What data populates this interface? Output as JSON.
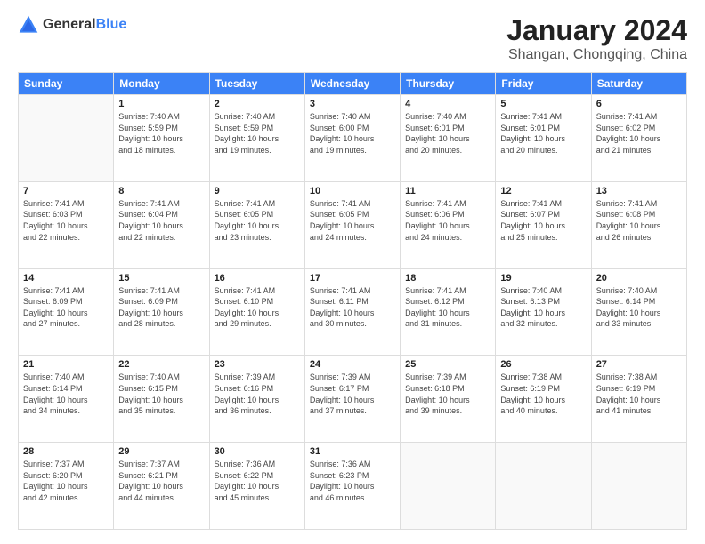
{
  "logo": {
    "general": "General",
    "blue": "Blue"
  },
  "header": {
    "title": "January 2024",
    "subtitle": "Shangan, Chongqing, China"
  },
  "weekdays": [
    "Sunday",
    "Monday",
    "Tuesday",
    "Wednesday",
    "Thursday",
    "Friday",
    "Saturday"
  ],
  "weeks": [
    [
      {
        "day": "",
        "info": ""
      },
      {
        "day": "1",
        "info": "Sunrise: 7:40 AM\nSunset: 5:59 PM\nDaylight: 10 hours\nand 18 minutes."
      },
      {
        "day": "2",
        "info": "Sunrise: 7:40 AM\nSunset: 5:59 PM\nDaylight: 10 hours\nand 19 minutes."
      },
      {
        "day": "3",
        "info": "Sunrise: 7:40 AM\nSunset: 6:00 PM\nDaylight: 10 hours\nand 19 minutes."
      },
      {
        "day": "4",
        "info": "Sunrise: 7:40 AM\nSunset: 6:01 PM\nDaylight: 10 hours\nand 20 minutes."
      },
      {
        "day": "5",
        "info": "Sunrise: 7:41 AM\nSunset: 6:01 PM\nDaylight: 10 hours\nand 20 minutes."
      },
      {
        "day": "6",
        "info": "Sunrise: 7:41 AM\nSunset: 6:02 PM\nDaylight: 10 hours\nand 21 minutes."
      }
    ],
    [
      {
        "day": "7",
        "info": "Sunrise: 7:41 AM\nSunset: 6:03 PM\nDaylight: 10 hours\nand 22 minutes."
      },
      {
        "day": "8",
        "info": "Sunrise: 7:41 AM\nSunset: 6:04 PM\nDaylight: 10 hours\nand 22 minutes."
      },
      {
        "day": "9",
        "info": "Sunrise: 7:41 AM\nSunset: 6:05 PM\nDaylight: 10 hours\nand 23 minutes."
      },
      {
        "day": "10",
        "info": "Sunrise: 7:41 AM\nSunset: 6:05 PM\nDaylight: 10 hours\nand 24 minutes."
      },
      {
        "day": "11",
        "info": "Sunrise: 7:41 AM\nSunset: 6:06 PM\nDaylight: 10 hours\nand 24 minutes."
      },
      {
        "day": "12",
        "info": "Sunrise: 7:41 AM\nSunset: 6:07 PM\nDaylight: 10 hours\nand 25 minutes."
      },
      {
        "day": "13",
        "info": "Sunrise: 7:41 AM\nSunset: 6:08 PM\nDaylight: 10 hours\nand 26 minutes."
      }
    ],
    [
      {
        "day": "14",
        "info": "Sunrise: 7:41 AM\nSunset: 6:09 PM\nDaylight: 10 hours\nand 27 minutes."
      },
      {
        "day": "15",
        "info": "Sunrise: 7:41 AM\nSunset: 6:09 PM\nDaylight: 10 hours\nand 28 minutes."
      },
      {
        "day": "16",
        "info": "Sunrise: 7:41 AM\nSunset: 6:10 PM\nDaylight: 10 hours\nand 29 minutes."
      },
      {
        "day": "17",
        "info": "Sunrise: 7:41 AM\nSunset: 6:11 PM\nDaylight: 10 hours\nand 30 minutes."
      },
      {
        "day": "18",
        "info": "Sunrise: 7:41 AM\nSunset: 6:12 PM\nDaylight: 10 hours\nand 31 minutes."
      },
      {
        "day": "19",
        "info": "Sunrise: 7:40 AM\nSunset: 6:13 PM\nDaylight: 10 hours\nand 32 minutes."
      },
      {
        "day": "20",
        "info": "Sunrise: 7:40 AM\nSunset: 6:14 PM\nDaylight: 10 hours\nand 33 minutes."
      }
    ],
    [
      {
        "day": "21",
        "info": "Sunrise: 7:40 AM\nSunset: 6:14 PM\nDaylight: 10 hours\nand 34 minutes."
      },
      {
        "day": "22",
        "info": "Sunrise: 7:40 AM\nSunset: 6:15 PM\nDaylight: 10 hours\nand 35 minutes."
      },
      {
        "day": "23",
        "info": "Sunrise: 7:39 AM\nSunset: 6:16 PM\nDaylight: 10 hours\nand 36 minutes."
      },
      {
        "day": "24",
        "info": "Sunrise: 7:39 AM\nSunset: 6:17 PM\nDaylight: 10 hours\nand 37 minutes."
      },
      {
        "day": "25",
        "info": "Sunrise: 7:39 AM\nSunset: 6:18 PM\nDaylight: 10 hours\nand 39 minutes."
      },
      {
        "day": "26",
        "info": "Sunrise: 7:38 AM\nSunset: 6:19 PM\nDaylight: 10 hours\nand 40 minutes."
      },
      {
        "day": "27",
        "info": "Sunrise: 7:38 AM\nSunset: 6:19 PM\nDaylight: 10 hours\nand 41 minutes."
      }
    ],
    [
      {
        "day": "28",
        "info": "Sunrise: 7:37 AM\nSunset: 6:20 PM\nDaylight: 10 hours\nand 42 minutes."
      },
      {
        "day": "29",
        "info": "Sunrise: 7:37 AM\nSunset: 6:21 PM\nDaylight: 10 hours\nand 44 minutes."
      },
      {
        "day": "30",
        "info": "Sunrise: 7:36 AM\nSunset: 6:22 PM\nDaylight: 10 hours\nand 45 minutes."
      },
      {
        "day": "31",
        "info": "Sunrise: 7:36 AM\nSunset: 6:23 PM\nDaylight: 10 hours\nand 46 minutes."
      },
      {
        "day": "",
        "info": ""
      },
      {
        "day": "",
        "info": ""
      },
      {
        "day": "",
        "info": ""
      }
    ]
  ]
}
